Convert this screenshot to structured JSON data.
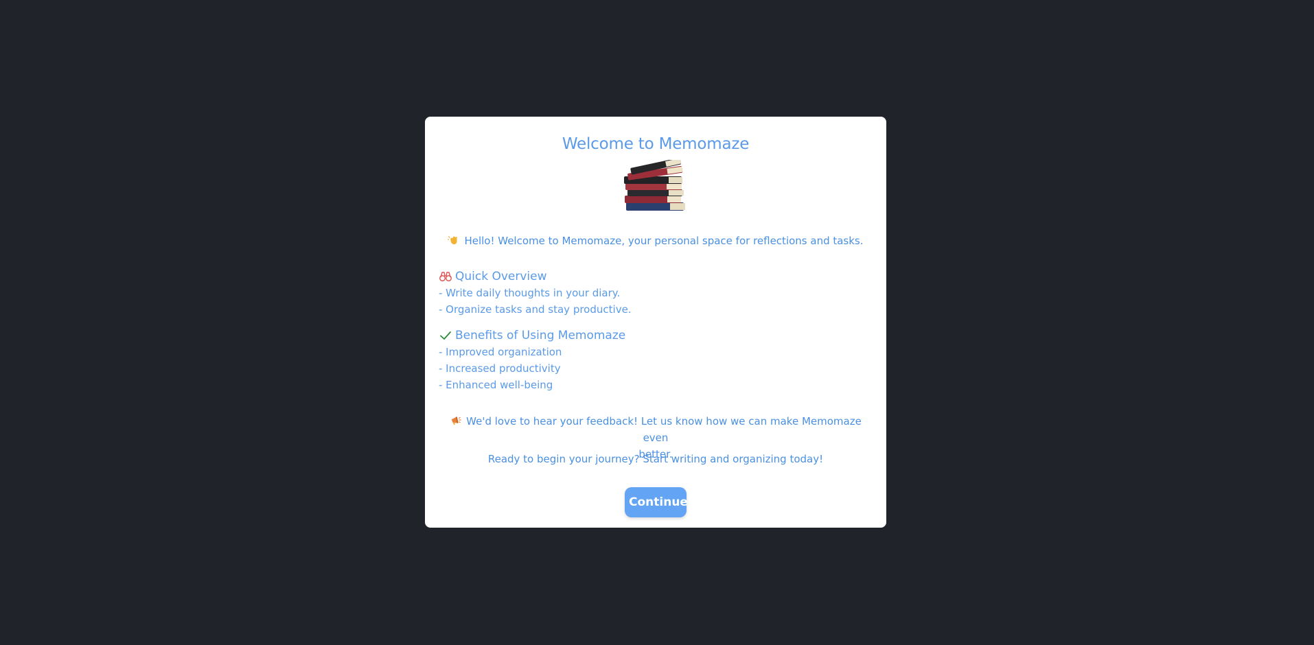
{
  "modal": {
    "title": "Welcome to Memomaze",
    "image_icon": "stack-of-books-image",
    "hello": {
      "icon": "waving-hand-icon",
      "text": "Hello! Welcome to Memomaze, your personal space for reflections and tasks."
    },
    "overview": {
      "icon": "binoculars-icon",
      "title": "Quick Overview",
      "items": [
        "- Write daily thoughts in your diary.",
        "- Organize tasks and stay productive."
      ]
    },
    "benefits": {
      "icon": "check-icon",
      "title": "Benefits of Using Memomaze",
      "items": [
        "- Improved organization",
        "- Increased productivity",
        "- Enhanced well-being"
      ]
    },
    "feedback": {
      "icon": "megaphone-icon",
      "line1": "We'd love to hear your feedback! Let us know how we can make Memomaze even",
      "line2": "better."
    },
    "ready": "Ready to begin your journey? Start writing and organizing today!",
    "continue_label": "Continue"
  },
  "colors": {
    "background": "#202329",
    "modal": "#ffffff",
    "accent": "#5a9ae8",
    "button": "#63a4f4",
    "binoculars": "#e05a5a",
    "check": "#2e8b3e"
  }
}
